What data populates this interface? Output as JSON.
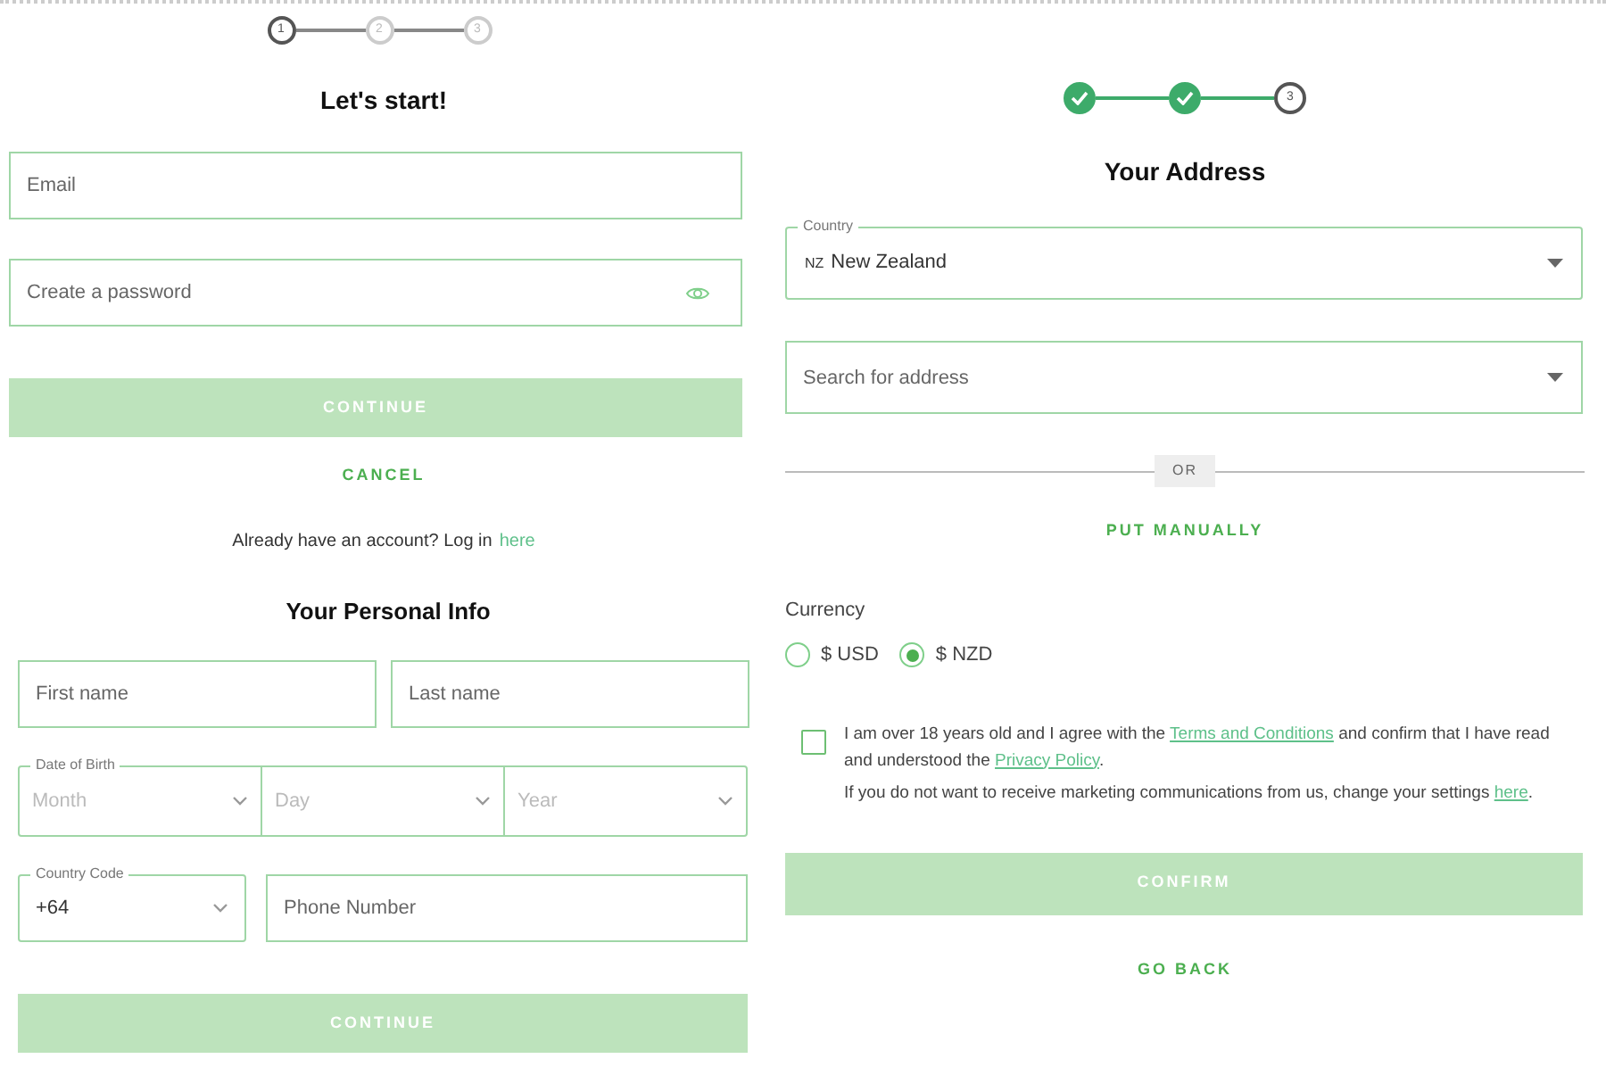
{
  "signup": {
    "stepper": [
      {
        "label": "1",
        "completed": false,
        "active": true
      },
      {
        "label": "2",
        "completed": false,
        "active": false
      },
      {
        "label": "3",
        "completed": false,
        "active": false
      }
    ],
    "title": "Let's start!",
    "fields": [
      {
        "kind": "text",
        "placeholder": "Email"
      },
      {
        "kind": "password",
        "placeholder": "Create a password"
      }
    ],
    "continue_button": "CONTINUE",
    "cancel_link": "CANCEL",
    "login_prompt": {
      "text": "Already have an account? Log in",
      "link": "here"
    }
  },
  "personal_info": {
    "title": "Your Personal Info",
    "name_fields": [
      {
        "placeholder": "First name"
      },
      {
        "placeholder": "Last name"
      }
    ],
    "date_of_birth": {
      "legend": "Date of Birth",
      "selects": [
        {
          "placeholder": "Month"
        },
        {
          "placeholder": "Day"
        },
        {
          "placeholder": "Year"
        }
      ]
    },
    "country_code": {
      "legend": "Country Code",
      "value": "+64"
    },
    "phone": {
      "placeholder": "Phone Number"
    },
    "continue_button": "CONTINUE"
  },
  "address": {
    "stepper": [
      {
        "completed": true
      },
      {
        "completed": true
      },
      {
        "label": "3",
        "completed": false,
        "active": true
      }
    ],
    "title": "Your Address",
    "country": {
      "legend": "Country",
      "code": "NZ",
      "value": "New Zealand"
    },
    "search": {
      "placeholder": "Search for address"
    },
    "divider_label": "OR",
    "manual_link": "PUT MANUALLY",
    "currency": {
      "label": "Currency",
      "options": [
        {
          "label": "$ USD",
          "selected": false
        },
        {
          "label": "$ NZD",
          "selected": true
        }
      ]
    },
    "consent": {
      "checked": false,
      "paragraphs": [
        [
          {
            "kind": "plain",
            "text": "I am over 18 years old and I agree with the "
          },
          {
            "kind": "link",
            "text": "Terms and Conditions"
          },
          {
            "kind": "plain",
            "text": " and confirm that I have read and understood the "
          },
          {
            "kind": "link",
            "text": "Privacy Policy"
          },
          {
            "kind": "plain",
            "text": "."
          }
        ],
        [
          {
            "kind": "plain",
            "text": "If you do not want to receive marketing communications from us, change your settings "
          },
          {
            "kind": "link",
            "text": "here"
          },
          {
            "kind": "plain",
            "text": "."
          }
        ]
      ]
    },
    "confirm_button": "CONFIRM",
    "back_link": "GO BACK"
  }
}
